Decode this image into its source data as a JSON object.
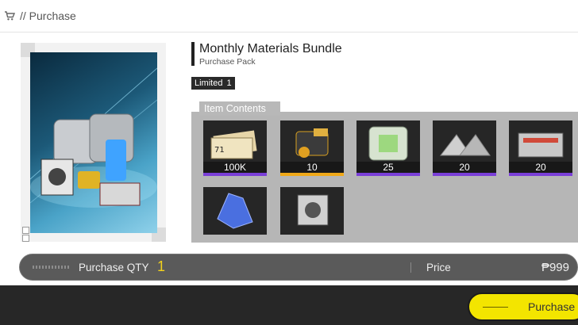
{
  "header": {
    "breadcrumb": "// Purchase",
    "icon": "cart-icon"
  },
  "product": {
    "title": "Monthly Materials Bundle",
    "subtitle": "Purchase Pack",
    "limited_label": "Limited",
    "limited_count": "1"
  },
  "contents": {
    "tab_label": "Item Contents",
    "items": [
      {
        "name": "credit-tickets",
        "qty": "100K",
        "rarity": "purple"
      },
      {
        "name": "battery-module",
        "qty": "10",
        "rarity": "gold"
      },
      {
        "name": "green-core-cube",
        "qty": "25",
        "rarity": "purple"
      },
      {
        "name": "triangle-plates",
        "qty": "20",
        "rarity": "purple"
      },
      {
        "name": "metal-crate",
        "qty": "20",
        "rarity": "purple"
      },
      {
        "name": "blue-crystal",
        "qty": "",
        "rarity": "none"
      },
      {
        "name": "steel-cube",
        "qty": "",
        "rarity": "none"
      }
    ]
  },
  "purchase": {
    "qty_label": "Purchase QTY",
    "qty_value": "1",
    "price_label": "Price",
    "price_value": "₱999",
    "button_label": "Purchase"
  },
  "colors": {
    "accent_yellow": "#f3e500",
    "rarity_purple": "#7a3fd8",
    "rarity_gold": "#f0a818"
  }
}
